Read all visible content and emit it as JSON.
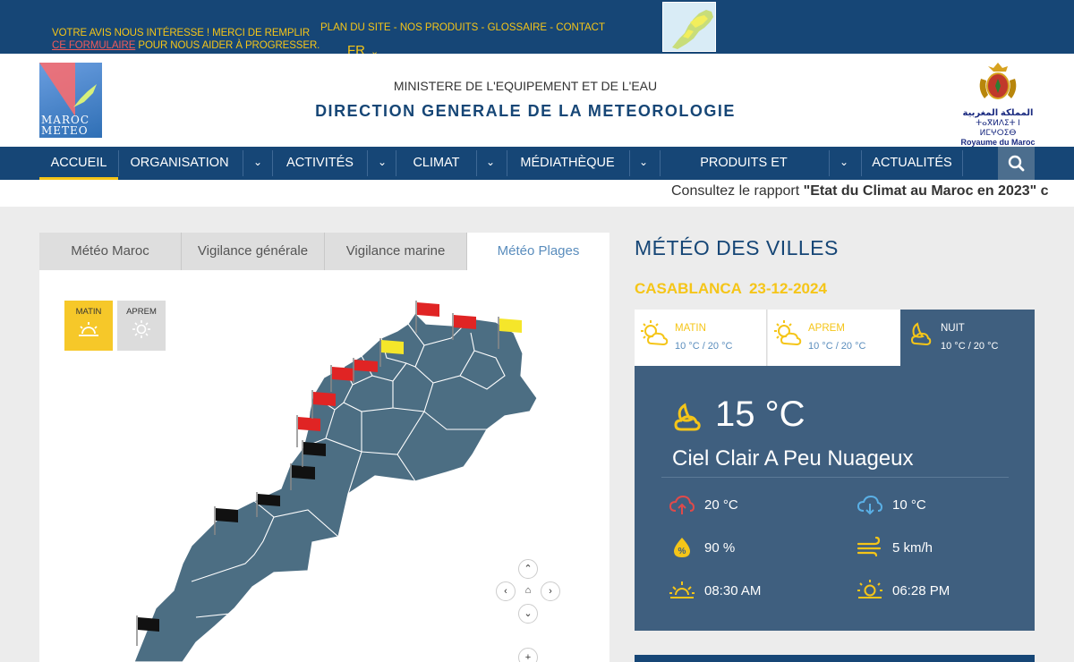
{
  "topbar": {
    "feedback_pre": "VOTRE AVIS NOUS INTÉRESSE ! MERCI DE REMPLIR",
    "feedback_link": "CE FORMULAIRE",
    "feedback_post": " POUR NOUS AIDER À PROGRESSER.",
    "links": "PLAN DU SITE - NOS PRODUITS - GLOSSAIRE - CONTACT",
    "lang": "FR"
  },
  "header": {
    "logo_line1": "MAROC",
    "logo_line2": "METEO",
    "ministry": "MINISTERE DE L'EQUIPEMENT ET DE L'EAU",
    "direction": "DIRECTION GENERALE DE LA METEOROLOGIE",
    "crest_ar": "المملكة المغربية",
    "crest_am": "ⵜⴰⴳⵍⴷⵉⵜ ⵏ ⵍⵎⵖⵔⵉⴱ",
    "crest_fr": "Royaume du Maroc"
  },
  "nav": {
    "items": [
      "ACCUEIL",
      "ORGANISATION",
      "ACTIVITÉS",
      "CLIMAT",
      "MÉDIATHÈQUE",
      "PRODUITS ET SERVICES",
      "ACTUALITÉS"
    ]
  },
  "ticker": {
    "prefix": "Consultez le rapport ",
    "title": "\"Etat du Climat au Maroc en 2023\" c"
  },
  "map_panel": {
    "tabs": [
      "Météo Maroc",
      "Vigilance générale",
      "Vigilance marine",
      "Météo Plages"
    ],
    "periods": [
      "MATIN",
      "APREM"
    ]
  },
  "cities": {
    "title": "MÉTÉO DES VILLES",
    "city": "CASABLANCA",
    "date": "23-12-2024",
    "periods": [
      {
        "label": "MATIN",
        "range": "10 °C / 20 °C"
      },
      {
        "label": "APREM",
        "range": "10 °C / 20 °C"
      },
      {
        "label": "NUIT",
        "range": "10 °C / 20 °C"
      }
    ],
    "current_temp": "15 °C",
    "condition": "Ciel Clair A Peu Nuageux",
    "tmax": "20 °C",
    "tmin": "10 °C",
    "humidity": "90 %",
    "wind": "5 km/h",
    "sunrise": "08:30 AM",
    "sunset": "06:28 PM"
  },
  "colors": {
    "navy": "#164676",
    "yellow": "#f5c518",
    "panel": "#3f5f7f",
    "map_land": "#4c6e83"
  }
}
